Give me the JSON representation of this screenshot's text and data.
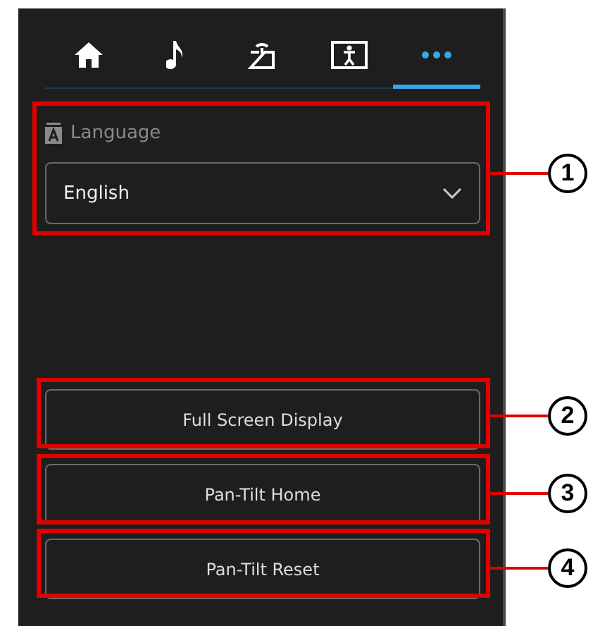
{
  "tabs": [
    {
      "kind": "home",
      "selected": false
    },
    {
      "kind": "note",
      "selected": false
    },
    {
      "kind": "tray",
      "selected": false
    },
    {
      "kind": "person",
      "selected": false
    },
    {
      "kind": "more",
      "selected": true
    }
  ],
  "language": {
    "label": "Language",
    "value": "English"
  },
  "buttons": [
    "Full Screen Display",
    "Pan-Tilt Home",
    "Pan-Tilt Reset"
  ],
  "callouts": [
    {
      "number": "1"
    },
    {
      "number": "2"
    },
    {
      "number": "3"
    },
    {
      "number": "4"
    }
  ]
}
